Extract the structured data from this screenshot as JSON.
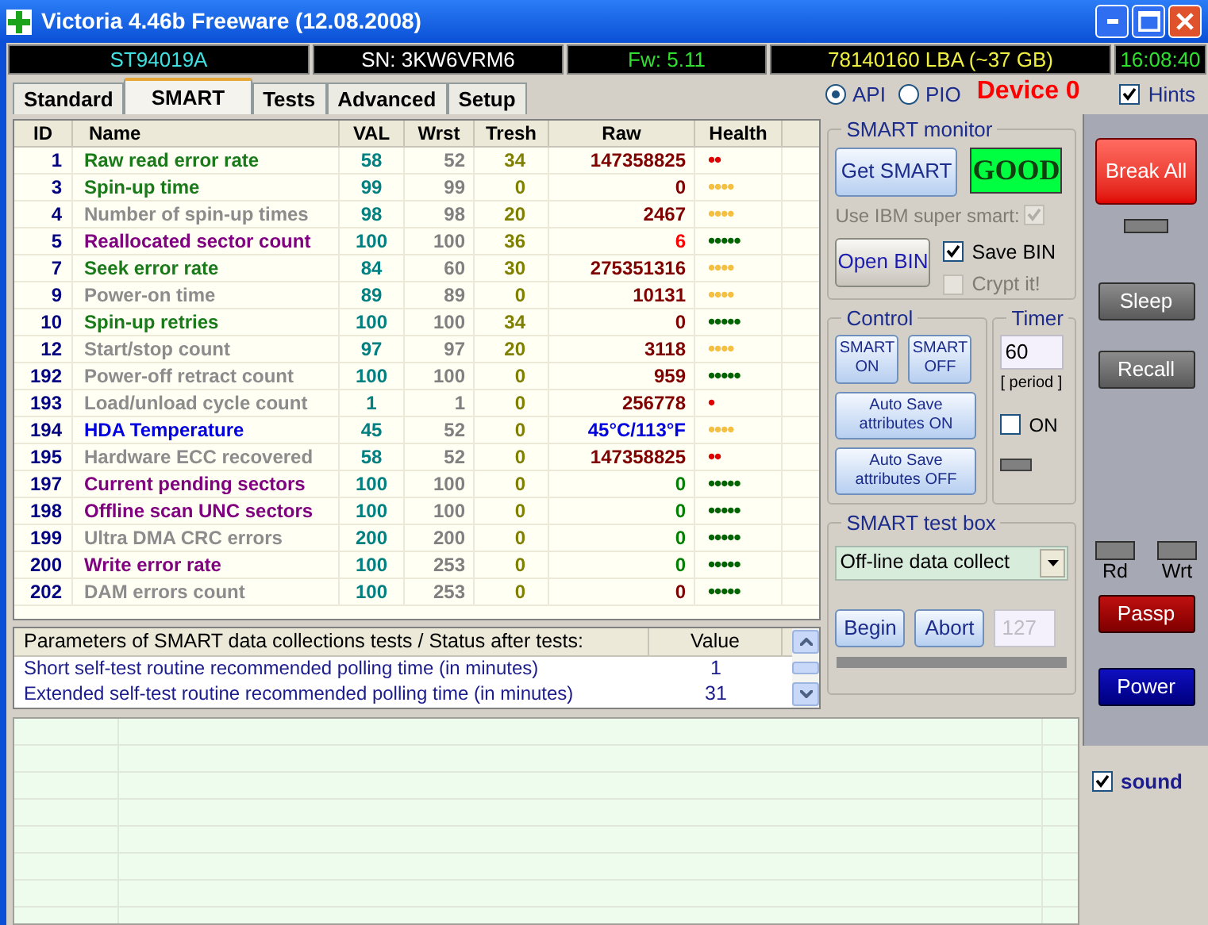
{
  "window": {
    "title": "Victoria 4.46b Freeware (12.08.2008)"
  },
  "info_bar": {
    "model": "ST94019A",
    "serial": "SN: 3KW6VRM6",
    "firmware": "Fw: 5.11",
    "capacity": "78140160 LBA (~37 GB)",
    "clock": "16:08:40"
  },
  "tabs": [
    {
      "label": "Standard",
      "selected": false
    },
    {
      "label": "SMART",
      "selected": true
    },
    {
      "label": "Tests",
      "selected": false
    },
    {
      "label": "Advanced",
      "selected": false
    },
    {
      "label": "Setup",
      "selected": false
    }
  ],
  "mode": [
    {
      "label": "API",
      "selected": true
    },
    {
      "label": "PIO",
      "selected": false
    }
  ],
  "device": "Device 0",
  "hints": {
    "label": "Hints",
    "checked": true
  },
  "smart_table": {
    "columns": [
      "ID",
      "Name",
      "VAL",
      "Wrst",
      "Tresh",
      "Raw",
      "Health"
    ],
    "rows": [
      {
        "id": "1",
        "name": {
          "text": "Raw read error rate",
          "color": "#1a7a1a"
        },
        "val": "58",
        "wrst": "52",
        "tresh": "34",
        "raw": {
          "text": "147358825",
          "color": "#800000"
        },
        "health": {
          "text": "••",
          "color": "#e00000"
        }
      },
      {
        "id": "3",
        "name": {
          "text": "Spin-up time",
          "color": "#1a7a1a"
        },
        "val": "99",
        "wrst": "99",
        "tresh": "0",
        "raw": {
          "text": "0",
          "color": "#800000"
        },
        "health": {
          "text": "••••",
          "color": "#f5c040"
        }
      },
      {
        "id": "4",
        "name": {
          "text": "Number of spin-up times",
          "color": "#8c8c8c"
        },
        "val": "98",
        "wrst": "98",
        "tresh": "20",
        "raw": {
          "text": "2467",
          "color": "#800000"
        },
        "health": {
          "text": "••••",
          "color": "#f5c040"
        }
      },
      {
        "id": "5",
        "name": {
          "text": "Reallocated sector count",
          "color": "#800080"
        },
        "val": "100",
        "wrst": "100",
        "tresh": "36",
        "raw": {
          "text": "6",
          "color": "#ff0000"
        },
        "health": {
          "text": "•••••",
          "color": "#006400"
        }
      },
      {
        "id": "7",
        "name": {
          "text": "Seek error rate",
          "color": "#1a7a1a"
        },
        "val": "84",
        "wrst": "60",
        "tresh": "30",
        "raw": {
          "text": "275351316",
          "color": "#800000"
        },
        "health": {
          "text": "••••",
          "color": "#f5c040"
        }
      },
      {
        "id": "9",
        "name": {
          "text": "Power-on time",
          "color": "#8c8c8c"
        },
        "val": "89",
        "wrst": "89",
        "tresh": "0",
        "raw": {
          "text": "10131",
          "color": "#800000"
        },
        "health": {
          "text": "••••",
          "color": "#f5c040"
        }
      },
      {
        "id": "10",
        "name": {
          "text": "Spin-up retries",
          "color": "#1a7a1a"
        },
        "val": "100",
        "wrst": "100",
        "tresh": "34",
        "raw": {
          "text": "0",
          "color": "#800000"
        },
        "health": {
          "text": "•••••",
          "color": "#006400"
        }
      },
      {
        "id": "12",
        "name": {
          "text": "Start/stop count",
          "color": "#8c8c8c"
        },
        "val": "97",
        "wrst": "97",
        "tresh": "20",
        "raw": {
          "text": "3118",
          "color": "#800000"
        },
        "health": {
          "text": "••••",
          "color": "#f5c040"
        }
      },
      {
        "id": "192",
        "name": {
          "text": "Power-off retract count",
          "color": "#8c8c8c"
        },
        "val": "100",
        "wrst": "100",
        "tresh": "0",
        "raw": {
          "text": "959",
          "color": "#800000"
        },
        "health": {
          "text": "•••••",
          "color": "#006400"
        }
      },
      {
        "id": "193",
        "name": {
          "text": "Load/unload cycle count",
          "color": "#8c8c8c"
        },
        "val": "1",
        "wrst": "1",
        "tresh": "0",
        "raw": {
          "text": "256778",
          "color": "#800000"
        },
        "health": {
          "text": "•",
          "color": "#e00000"
        }
      },
      {
        "id": "194",
        "name": {
          "text": "HDA Temperature",
          "color": "#0000e0"
        },
        "val": "45",
        "wrst": "52",
        "tresh": "0",
        "raw": {
          "text": "45°C/113°F",
          "color": "#0000e0"
        },
        "health": {
          "text": "••••",
          "color": "#f5c040"
        }
      },
      {
        "id": "195",
        "name": {
          "text": "Hardware ECC recovered",
          "color": "#8c8c8c"
        },
        "val": "58",
        "wrst": "52",
        "tresh": "0",
        "raw": {
          "text": "147358825",
          "color": "#800000"
        },
        "health": {
          "text": "••",
          "color": "#e00000"
        }
      },
      {
        "id": "197",
        "name": {
          "text": "Current pending sectors",
          "color": "#800080"
        },
        "val": "100",
        "wrst": "100",
        "tresh": "0",
        "raw": {
          "text": "0",
          "color": "#008000"
        },
        "health": {
          "text": "•••••",
          "color": "#006400"
        }
      },
      {
        "id": "198",
        "name": {
          "text": "Offline scan UNC sectors",
          "color": "#800080"
        },
        "val": "100",
        "wrst": "100",
        "tresh": "0",
        "raw": {
          "text": "0",
          "color": "#008000"
        },
        "health": {
          "text": "•••••",
          "color": "#006400"
        }
      },
      {
        "id": "199",
        "name": {
          "text": "Ultra DMA CRC errors",
          "color": "#8c8c8c"
        },
        "val": "200",
        "wrst": "200",
        "tresh": "0",
        "raw": {
          "text": "0",
          "color": "#008000"
        },
        "health": {
          "text": "•••••",
          "color": "#006400"
        }
      },
      {
        "id": "200",
        "name": {
          "text": "Write error rate",
          "color": "#800080"
        },
        "val": "100",
        "wrst": "253",
        "tresh": "0",
        "raw": {
          "text": "0",
          "color": "#008000"
        },
        "health": {
          "text": "•••••",
          "color": "#006400"
        }
      },
      {
        "id": "202",
        "name": {
          "text": "DAM errors count",
          "color": "#8c8c8c"
        },
        "val": "100",
        "wrst": "253",
        "tresh": "0",
        "raw": {
          "text": "0",
          "color": "#800000"
        },
        "health": {
          "text": "•••••",
          "color": "#006400"
        }
      }
    ]
  },
  "tests_table": {
    "columns": [
      "Parameters of SMART data collections tests / Status after tests:",
      "Value"
    ],
    "rows": [
      {
        "parameter": "Short self-test routine recommended polling time (in minutes)",
        "value": "1"
      },
      {
        "parameter": "Extended self-test routine recommended polling time (in minutes)",
        "value": "31"
      }
    ]
  },
  "smart_monitor": {
    "title": "SMART monitor",
    "get_button": "Get SMART",
    "status": "GOOD",
    "ibm": {
      "label": "Use IBM super smart:",
      "checked": true,
      "disabled": true
    },
    "open_button": "Open BIN",
    "save_bin": {
      "label": "Save BIN",
      "checked": true,
      "disabled": false
    },
    "crypt": {
      "label": "Crypt it!",
      "checked": false,
      "disabled": true
    }
  },
  "control": {
    "title": "Control",
    "buttons": [
      [
        "SMART",
        "ON"
      ],
      [
        "SMART",
        "OFF"
      ]
    ],
    "auto_buttons": [
      [
        "Auto Save",
        "attributes ON"
      ],
      [
        "Auto Save",
        "attributes OFF"
      ]
    ]
  },
  "timer": {
    "title": "Timer",
    "value": "60",
    "caption": "[ period ]",
    "on": {
      "label": "ON",
      "checked": false
    }
  },
  "test_box": {
    "title": "SMART test box",
    "selection": "Off-line data collect",
    "begin": "Begin",
    "abort": "Abort",
    "field": "127",
    "progress": {
      "level": 0
    }
  },
  "side": {
    "break_all": "Break All",
    "sleep": "Sleep",
    "recall": "Recall",
    "rd": "Rd",
    "wrt": "Wrt",
    "passp": "Passp",
    "power": "Power",
    "sound": {
      "label": "sound",
      "checked": true
    }
  }
}
